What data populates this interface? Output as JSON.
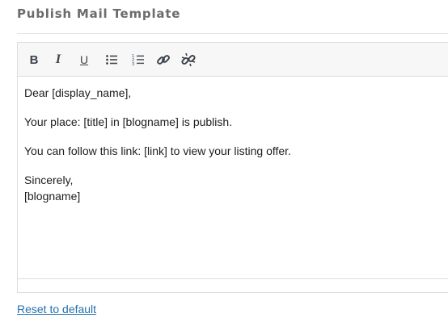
{
  "page": {
    "title": "Publish Mail Template"
  },
  "toolbar": {
    "bold_label": "B",
    "italic_label": "I",
    "underline_label": "U",
    "icons": [
      "bold-icon",
      "italic-icon",
      "underline-icon",
      "bulleted-list-icon",
      "numbered-list-icon",
      "link-icon",
      "unlink-icon"
    ]
  },
  "editor": {
    "lines": [
      "Dear [display_name],",
      "Your place: [title] in [blogname] is publish.",
      "You can follow this link: [link] to view your listing offer.",
      "Sincerely,",
      "[blogname]"
    ]
  },
  "footer": {
    "reset_label": "Reset to default"
  },
  "colors": {
    "title": "#6b6b6b",
    "link": "#2271b1",
    "toolbar_bg": "#f7f7f7",
    "border": "#dddddd"
  }
}
